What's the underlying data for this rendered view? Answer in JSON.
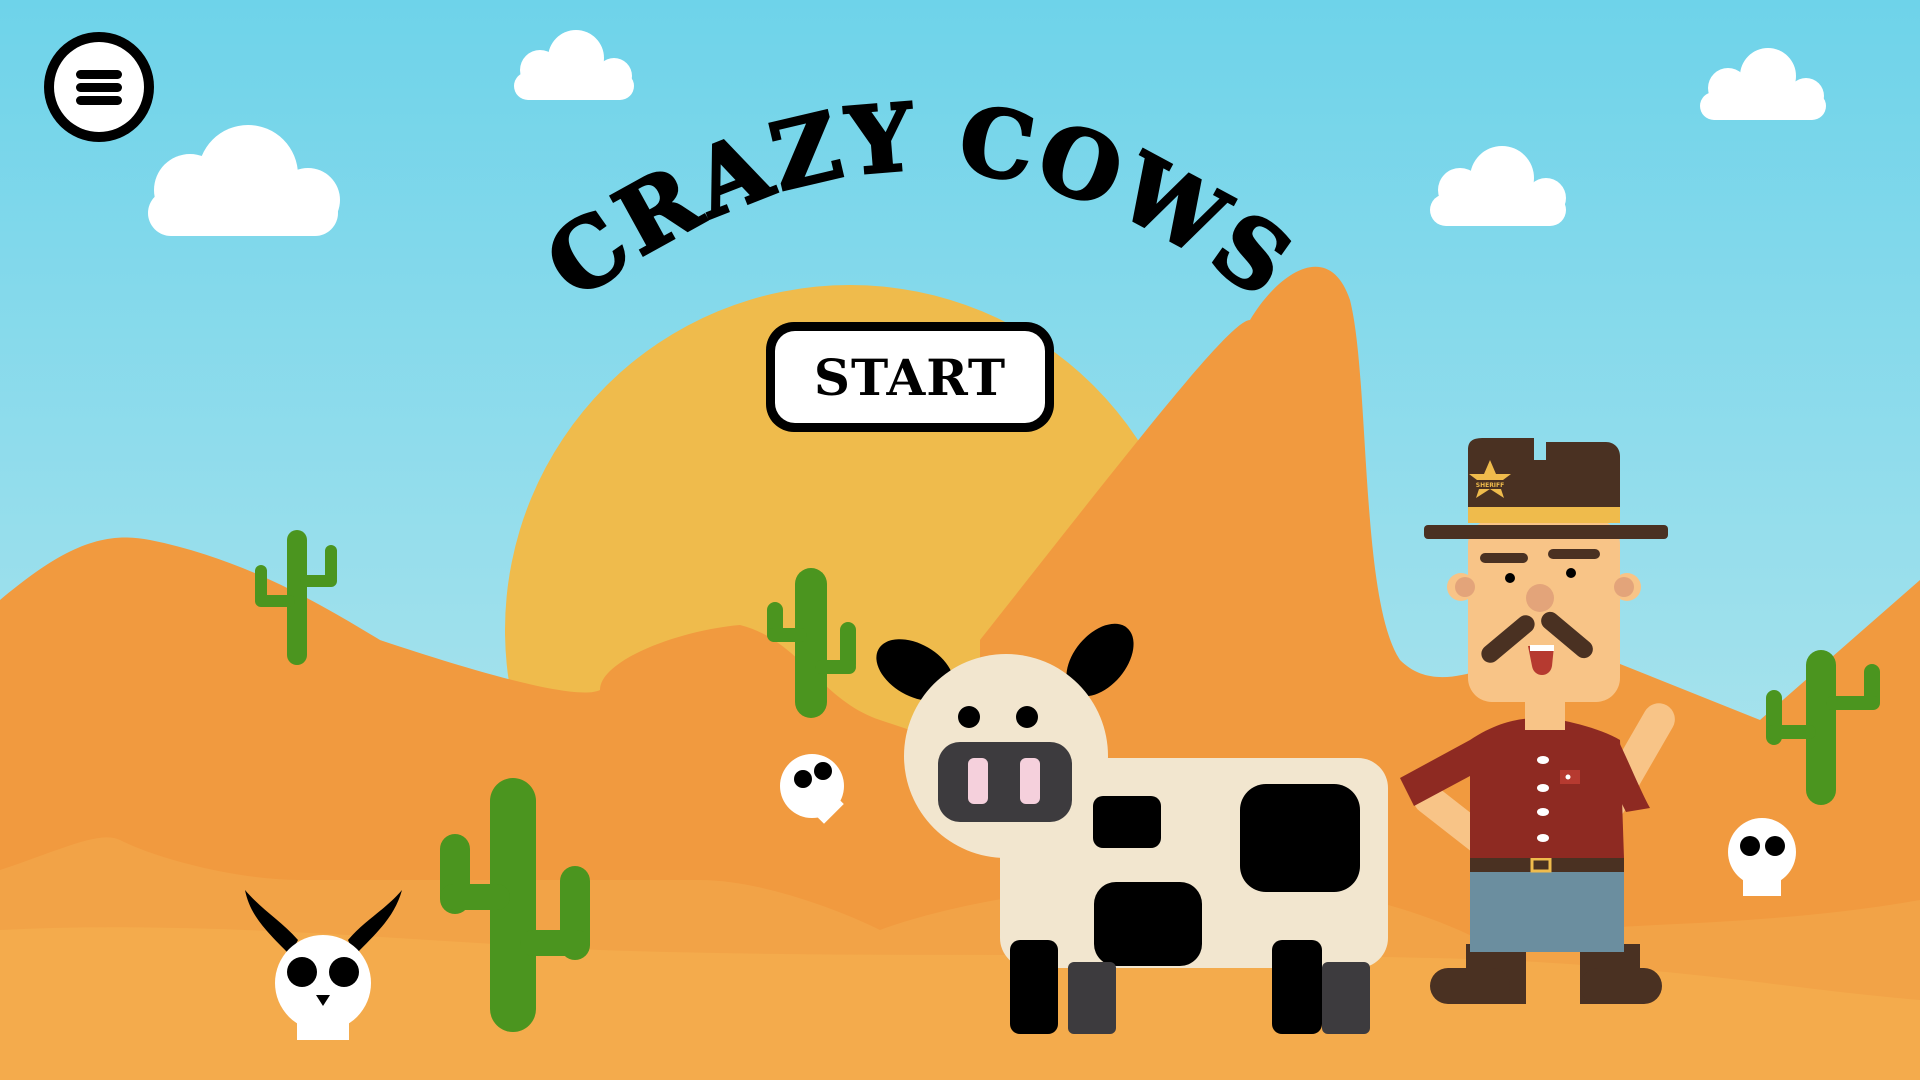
{
  "game": {
    "title": "CRAZY COWS",
    "start_label": "START",
    "sheriff_badge_text": "SHERIFF",
    "menu_icon": "hamburger-menu-icon"
  },
  "colors": {
    "sky_top": "#6ed3ea",
    "sky_bottom": "#bfe9ee",
    "sun": "#efbb4c",
    "dune_far": "#f19a3f",
    "dune_mid": "#f2a347",
    "dune_near": "#f4ab4c",
    "cactus": "#4b951f",
    "cow_body": "#f2e6cf",
    "sheriff_shirt": "#8e2a22",
    "sheriff_hat": "#4a3122"
  }
}
